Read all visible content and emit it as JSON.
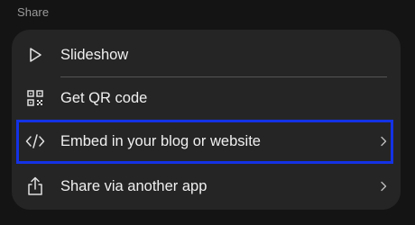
{
  "section_label": "Share",
  "menu": {
    "items": [
      {
        "label": "Slideshow",
        "icon": "play-icon"
      },
      {
        "label": "Get QR code",
        "icon": "qr-code-icon"
      },
      {
        "label": "Embed in your blog or website",
        "icon": "code-icon",
        "has_chevron": true,
        "highlighted": true
      },
      {
        "label": "Share via another app",
        "icon": "share-upload-icon",
        "has_chevron": true
      }
    ]
  },
  "colors": {
    "background": "#141414",
    "card": "#252525",
    "text": "#f0f0f0",
    "muted_text": "#9a9a9a",
    "divider": "#555555",
    "highlight_border": "#1432e6"
  }
}
